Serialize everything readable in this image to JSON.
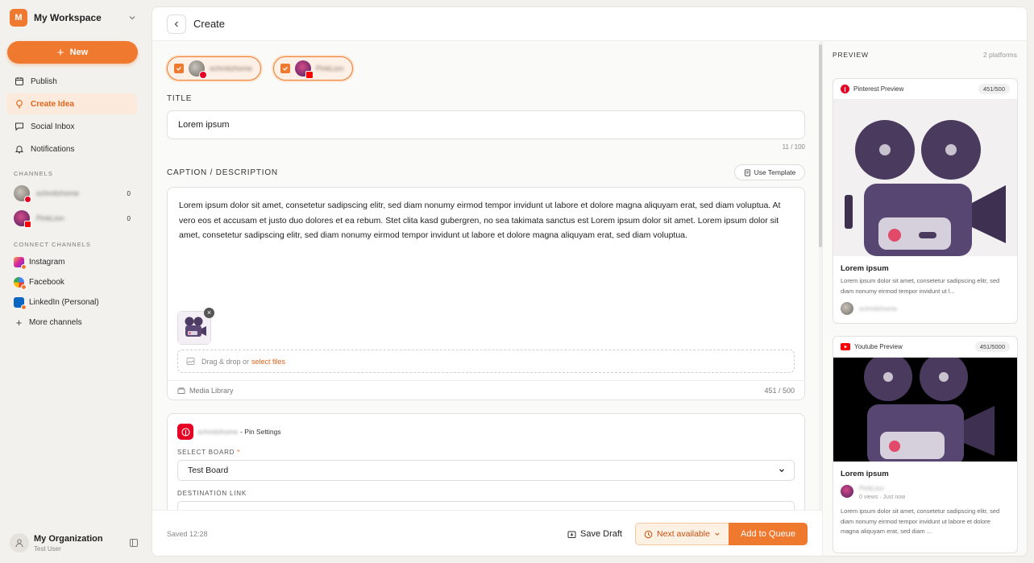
{
  "workspace": {
    "badge": "M",
    "name": "My Workspace"
  },
  "sidebar": {
    "new_label": "New",
    "nav": [
      {
        "label": "Publish",
        "icon": "calendar-icon"
      },
      {
        "label": "Create Idea",
        "icon": "lightbulb-icon",
        "active": true
      },
      {
        "label": "Social Inbox",
        "icon": "chat-icon"
      },
      {
        "label": "Notifications",
        "icon": "bell-icon"
      }
    ],
    "channels_label": "CHANNELS",
    "channels": [
      {
        "name": "schmitzhome",
        "count": "0",
        "network": "pinterest"
      },
      {
        "name": "PinkLion",
        "count": "0",
        "network": "youtube"
      }
    ],
    "connect_label": "CONNECT CHANNELS",
    "connect": [
      {
        "label": "Instagram",
        "icon": "instagram-icon"
      },
      {
        "label": "Facebook",
        "icon": "facebook-icon"
      },
      {
        "label": "LinkedIn (Personal)",
        "icon": "linkedin-icon"
      },
      {
        "label": "More channels",
        "icon": "plus-icon"
      }
    ],
    "org": {
      "name": "My Organization",
      "user": "Test User"
    }
  },
  "header": {
    "title": "Create"
  },
  "editor": {
    "chips": [
      {
        "name": "schmitzhome",
        "network": "pinterest"
      },
      {
        "name": "PinkLion",
        "network": "youtube"
      }
    ],
    "title_label": "TITLE",
    "title_value": "Lorem ipsum",
    "title_counter": "11 / 100",
    "caption_label": "CAPTION / DESCRIPTION",
    "template_label": "Use Template",
    "caption": "Lorem ipsum dolor sit amet, consetetur sadipscing elitr, sed diam nonumy eirmod tempor invidunt ut labore et dolore magna aliquyam erat, sed diam voluptua. At vero eos et accusam et justo duo dolores et ea rebum. Stet clita kasd gubergren, no sea takimata sanctus est Lorem ipsum dolor sit amet. Lorem ipsum dolor sit amet, consetetur sadipscing elitr, sed diam nonumy eirmod tempor invidunt ut labore et dolore magna aliquyam erat, sed diam voluptua.",
    "drop_text": "Drag & drop or",
    "drop_link": "select files",
    "media_library": "Media Library",
    "caption_counter": "451 / 500",
    "pin": {
      "account": "schmitzhome",
      "suffix": "- Pin Settings",
      "board_label": "SELECT BOARD",
      "board_required": "*",
      "board_value": "Test Board",
      "dest_label": "DESTINATION LINK"
    }
  },
  "footer": {
    "saved": "Saved 12:28",
    "save_draft": "Save Draft",
    "next_available": "Next available",
    "add_queue": "Add to Queue"
  },
  "preview": {
    "title": "PREVIEW",
    "count": "2 platforms",
    "pinterest": {
      "label": "Pinterest Preview",
      "count": "451/500",
      "title": "Lorem ipsum",
      "desc": "Lorem ipsum dolor sit amet, consetetur sadipscing elitr, sed diam nonumy eirmod tempor invidunt ut l...",
      "author": "schmitzhome"
    },
    "youtube": {
      "label": "Youtube Preview",
      "count": "451/5000",
      "title": "Lorem ipsum",
      "author": "PinkLion",
      "views": "0 views · Just now",
      "desc": "Lorem ipsum dolor sit amet, consetetur sadipscing elitr, sed diam nonumy eirmod tempor invidunt ut labore et dolore magna aliquyam erat, sed diam ..."
    }
  },
  "colors": {
    "accent": "#ef7a2f",
    "pinterest": "#e60023",
    "youtube": "#ff0000"
  }
}
